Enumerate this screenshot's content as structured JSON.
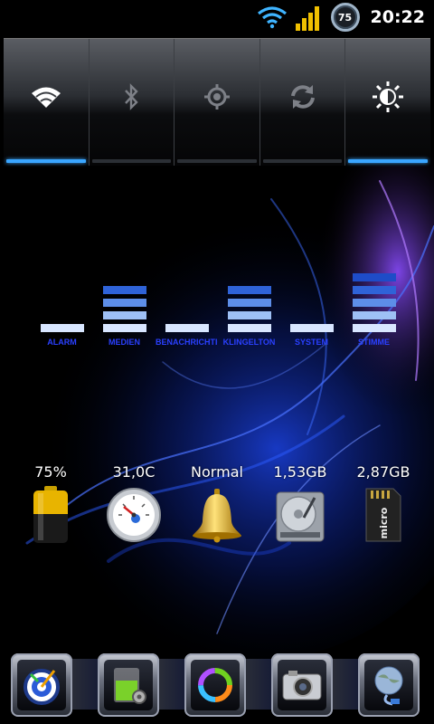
{
  "status_bar": {
    "battery_level": "75",
    "time": "20:22",
    "icons": [
      "wifi-icon",
      "signal-icon",
      "battery-ring-icon"
    ]
  },
  "toggles": [
    {
      "name": "wifi",
      "icon": "wifi-icon",
      "active": true
    },
    {
      "name": "bluetooth",
      "icon": "bluetooth-icon",
      "active": false
    },
    {
      "name": "gps",
      "icon": "gps-icon",
      "active": false
    },
    {
      "name": "sync",
      "icon": "sync-icon",
      "active": false
    },
    {
      "name": "brightness",
      "icon": "brightness-icon",
      "active": true
    }
  ],
  "volumes": [
    {
      "label": "ALARM",
      "level": 1
    },
    {
      "label": "MEDIEN",
      "level": 4
    },
    {
      "label": "BENACHRICHTIGUNG",
      "level": 1
    },
    {
      "label": "KLINGELTON",
      "level": 4
    },
    {
      "label": "SYSTEM",
      "level": 1
    },
    {
      "label": "STIMME",
      "level": 5
    }
  ],
  "stats": [
    {
      "value": "75%",
      "icon": "battery-icon"
    },
    {
      "value": "31,0C",
      "icon": "thermometer-gauge-icon"
    },
    {
      "value": "Normal",
      "icon": "bell-icon"
    },
    {
      "value": "1,53GB",
      "icon": "hard-drive-icon"
    },
    {
      "value": "2,87GB",
      "icon": "sd-card-icon"
    }
  ],
  "dock": [
    {
      "name": "target-app",
      "icon": "target-icon"
    },
    {
      "name": "battery-app",
      "icon": "green-battery-icon"
    },
    {
      "name": "ring-app",
      "icon": "colorful-ring-icon"
    },
    {
      "name": "camera-app",
      "icon": "camera-icon"
    },
    {
      "name": "network-app",
      "icon": "globe-icon"
    }
  ],
  "colors": {
    "accent_blue": "#3aa6ff",
    "volume_label": "#2a40ff",
    "volume_bar_dark": "#1e4cc8",
    "volume_bar_light": "#d8e6ff"
  }
}
